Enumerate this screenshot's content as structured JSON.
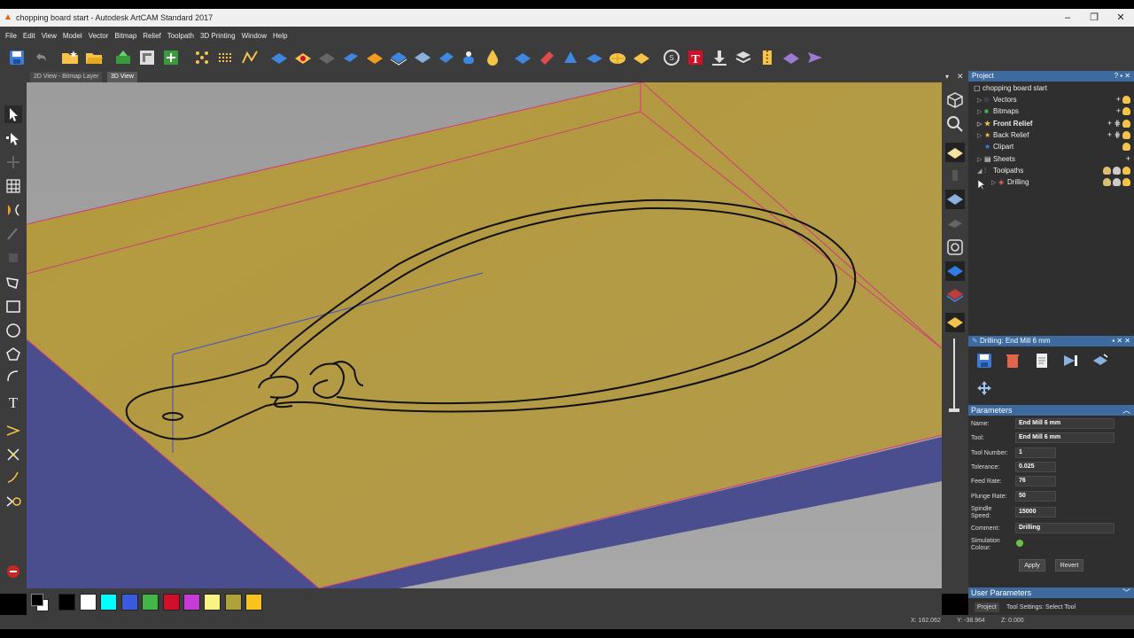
{
  "window": {
    "title": "chopping board start - Autodesk ArtCAM Standard 2017"
  },
  "menu": [
    "File",
    "Edit",
    "View",
    "Model",
    "Vector",
    "Bitmap",
    "Relief",
    "Toolpath",
    "3D Printing",
    "Window",
    "Help"
  ],
  "view_tabs": [
    "2D View - Bitmap Layer",
    "3D View"
  ],
  "project": {
    "header": "Project",
    "root": "chopping board start",
    "items": [
      {
        "label": "Vectors"
      },
      {
        "label": "Bitmaps"
      },
      {
        "label": "Front Relief"
      },
      {
        "label": "Back Relief"
      },
      {
        "label": "Clipart"
      },
      {
        "label": "Sheets"
      },
      {
        "label": "Toolpaths"
      },
      {
        "label": "Drilling"
      }
    ]
  },
  "tool_panel": {
    "header": "Drilling: End Mill 6 mm",
    "parameters_header": "Parameters",
    "fields": [
      {
        "label": "Name:",
        "value": "End Mill 6 mm"
      },
      {
        "label": "Tool:",
        "value": "End Mill 6 mm"
      },
      {
        "label": "Tool Number:",
        "value": "1"
      },
      {
        "label": "Tolerance:",
        "value": "0.025"
      },
      {
        "label": "Feed Rate:",
        "value": "76"
      },
      {
        "label": "Plunge Rate:",
        "value": "50"
      },
      {
        "label": "Spindle Speed:",
        "value": "15000"
      },
      {
        "label": "Comment:",
        "value": "Drilling"
      },
      {
        "label": "Simulation Colour:",
        "value": ""
      }
    ],
    "apply_label": "Apply",
    "revert_label": "Revert",
    "user_params_header": "User Parameters"
  },
  "bottom_tabs": [
    "Project",
    "Tool Settings: Select Tool"
  ],
  "status": {
    "x": "X: 162.062",
    "y": "Y: -38.964",
    "z": "Z: 0.000"
  },
  "palette": [
    "#000000",
    "#ffffff",
    "#00ffff",
    "#3a5bdf",
    "#43b649",
    "#d0102b",
    "#c63ad8",
    "#f7f383",
    "#b0a23a",
    "#f7c31c"
  ],
  "colors": {
    "accent": "#3d6ba0",
    "board": "#b59a3e",
    "board_edge": "#4b4e8e",
    "simulation": "#6cc04a"
  }
}
